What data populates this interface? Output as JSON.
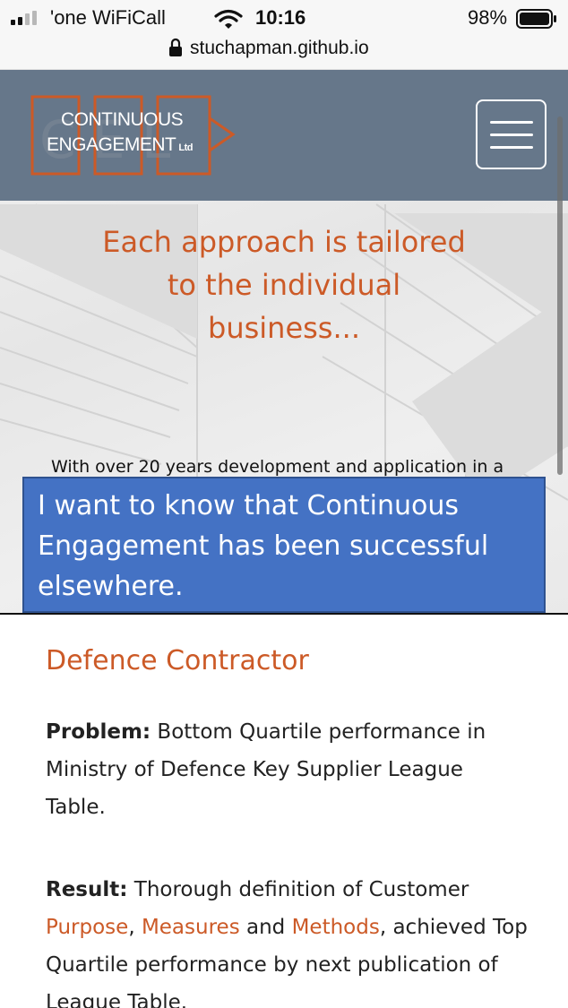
{
  "status_bar": {
    "carrier": "'one WiFiCall",
    "time": "10:16",
    "battery_percent": "98%",
    "icons": [
      "signal-bars-icon",
      "wifi-icon",
      "battery-icon"
    ]
  },
  "browser": {
    "url": "stuchapman.github.io",
    "icon": "lock-icon"
  },
  "navbar": {
    "logo_line1": "CONTINUOUS",
    "logo_line2": "ENGAGEMENT",
    "logo_suffix": "Ltd",
    "menu_icon": "hamburger-menu-icon"
  },
  "hero": {
    "tagline_line1": "Each approach is tailored",
    "tagline_line2": "to the individual",
    "tagline_line3": "business...",
    "intro_text": "With over 20 years development and application in a"
  },
  "callout": {
    "line1": "I want to know that Continuous",
    "line2": "Engagement has been successful",
    "line3": "elsewhere."
  },
  "case_study": {
    "title": "Defence Contractor",
    "problem_label": "Problem:",
    "problem_text": " Bottom Quartile performance in Ministry of Defence Key Supplier League Table.",
    "result_label": "Result:",
    "result_text_1": " Thorough definition of Customer ",
    "purpose": "Purpose",
    "comma": ", ",
    "measures": "Measures",
    "and": " and ",
    "methods": "Methods",
    "result_text_2": ", achieved Top Quartile performance by next publication of League Table."
  },
  "colors": {
    "accent": "#cc5a27",
    "navbar": "#66778a",
    "callout": "#4472c4"
  }
}
